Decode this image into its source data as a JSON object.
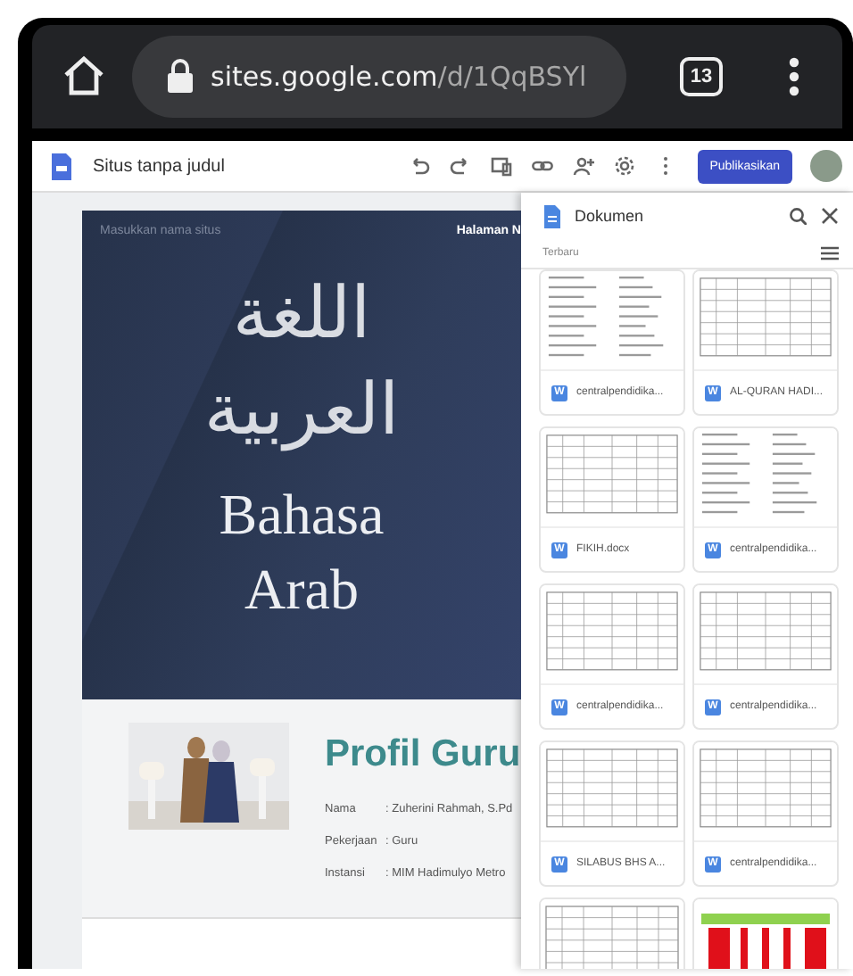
{
  "browser": {
    "url_host": "sites.google.com",
    "url_path": "/d/1QqBSYl",
    "tab_count": "13"
  },
  "toolbar": {
    "site_title": "Situs tanpa judul",
    "publish_button": "Publikasikan"
  },
  "hero": {
    "site_name_placeholder": "Masukkan nama situs",
    "nav_link": "Halaman N",
    "title_lines": [
      "اللغة",
      "العربية",
      "Bahasa",
      "Arab"
    ]
  },
  "profile": {
    "heading": "Profil Guru",
    "fields": [
      {
        "label": "Nama",
        "value": ": Zuherini Rahmah, S.Pd"
      },
      {
        "label": "Pekerjaan",
        "value": ": Guru"
      },
      {
        "label": "Instansi",
        "value": ": MIM Hadimulyo Metro"
      }
    ]
  },
  "documents_panel": {
    "title": "Dokumen",
    "sort_label": "Terbaru",
    "documents": [
      {
        "kind": "form",
        "badge": "W",
        "name": "centralpendidika..."
      },
      {
        "kind": "table",
        "badge": "W",
        "name": "AL-QURAN HADI..."
      },
      {
        "kind": "table",
        "badge": "W",
        "name": "FIKIH.docx"
      },
      {
        "kind": "form",
        "badge": "W",
        "name": "centralpendidika..."
      },
      {
        "kind": "table",
        "badge": "W",
        "name": "centralpendidika..."
      },
      {
        "kind": "table",
        "badge": "W",
        "name": "centralpendidika..."
      },
      {
        "kind": "table",
        "badge": "W",
        "name": "SILABUS BHS A..."
      },
      {
        "kind": "table",
        "badge": "W",
        "name": "centralpendidika..."
      },
      {
        "kind": "table"
      },
      {
        "kind": "chart"
      }
    ]
  }
}
